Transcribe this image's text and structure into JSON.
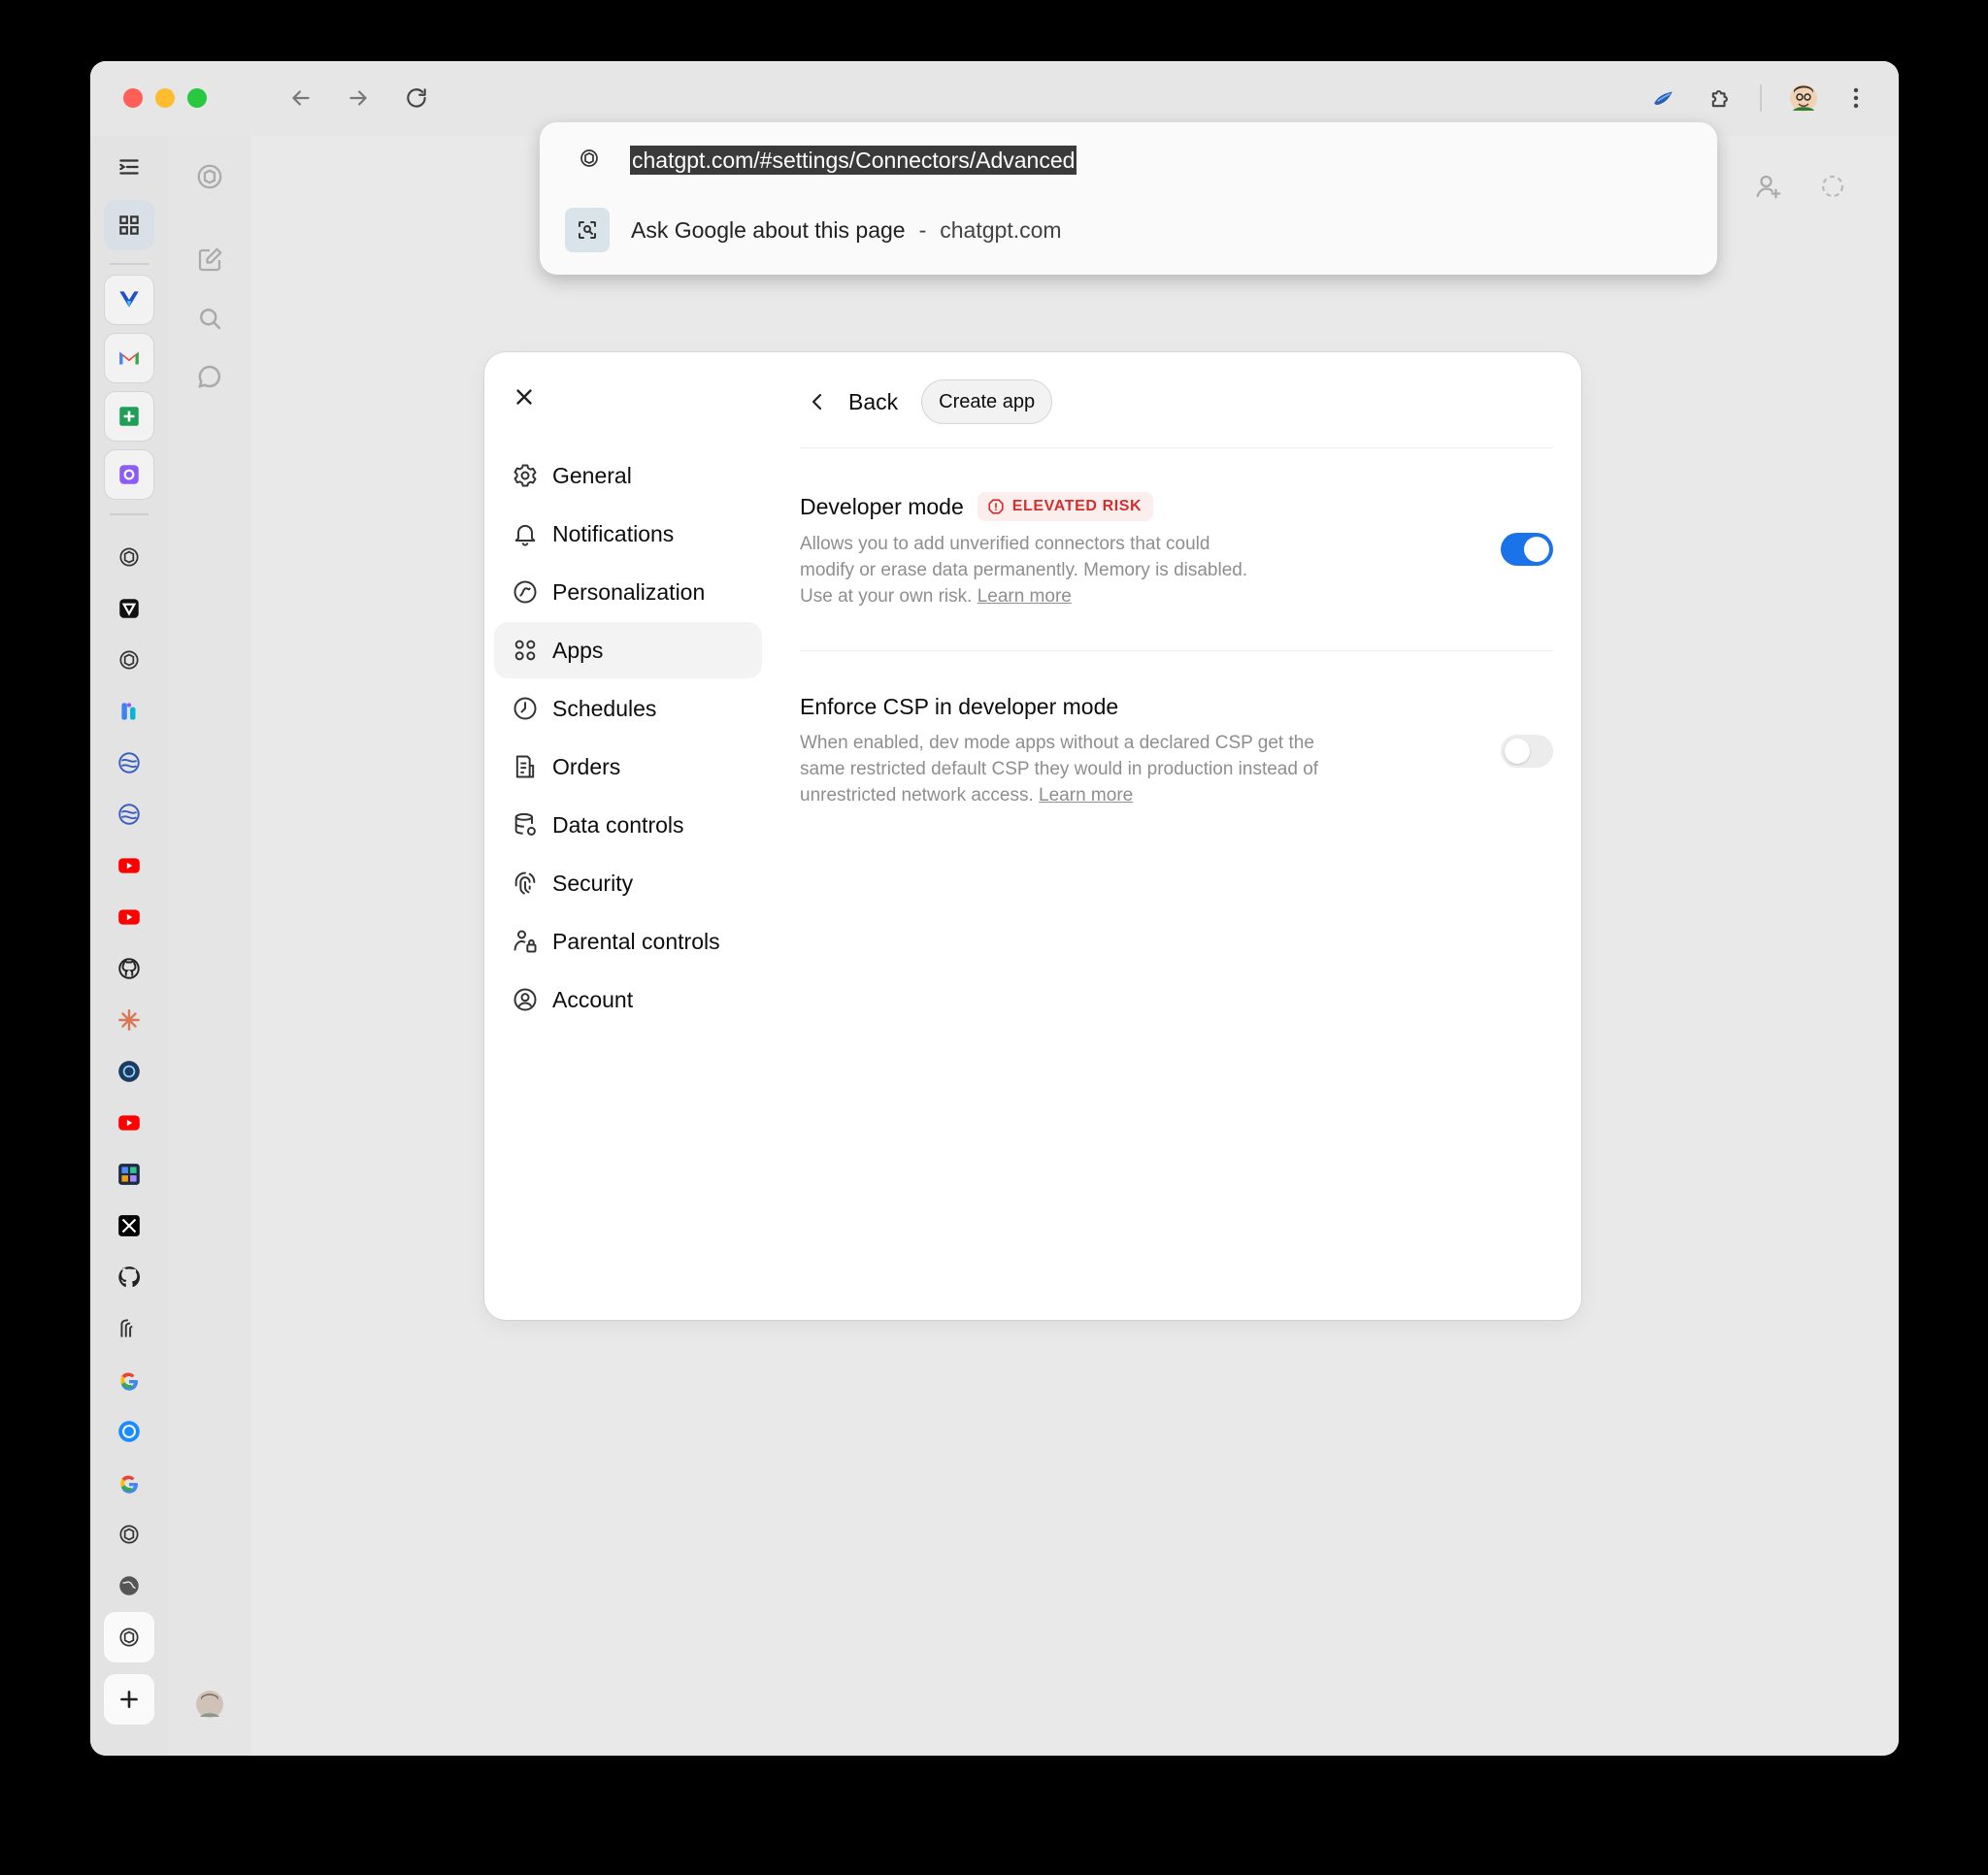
{
  "browser": {
    "url": "chatgpt.com/#settings/Connectors/Advanced",
    "suggestion": {
      "text": "Ask Google about this page",
      "separator": "-",
      "site": "chatgpt.com"
    }
  },
  "settings_nav": [
    {
      "label": "General",
      "icon": "gear-icon",
      "active": false
    },
    {
      "label": "Notifications",
      "icon": "bell-icon",
      "active": false
    },
    {
      "label": "Personalization",
      "icon": "personalization-icon",
      "active": false
    },
    {
      "label": "Apps",
      "icon": "apps-grid-icon",
      "active": true
    },
    {
      "label": "Schedules",
      "icon": "clock-icon",
      "active": false
    },
    {
      "label": "Orders",
      "icon": "orders-icon",
      "active": false
    },
    {
      "label": "Data controls",
      "icon": "database-icon",
      "active": false
    },
    {
      "label": "Security",
      "icon": "security-icon",
      "active": false
    },
    {
      "label": "Parental controls",
      "icon": "parental-icon",
      "active": false
    },
    {
      "label": "Account",
      "icon": "account-icon",
      "active": false
    }
  ],
  "header": {
    "back_label": "Back",
    "create_label": "Create app"
  },
  "developer_mode": {
    "title": "Developer mode",
    "badge": "ELEVATED RISK",
    "description": "Allows you to add unverified connectors that could modify or erase data permanently. Memory is disabled. Use at your own risk.",
    "link": "Learn more",
    "enabled": true
  },
  "enforce_csp": {
    "title": "Enforce CSP in developer mode",
    "description": "When enabled, dev mode apps without a declared CSP get the same restricted default CSP they would in production instead of unrestricted network access.",
    "link": "Learn more",
    "enabled": false
  },
  "colors": {
    "toggle_on": "#1a73e8",
    "badge_text": "#d22f2f",
    "badge_bg": "#fdeeee"
  }
}
